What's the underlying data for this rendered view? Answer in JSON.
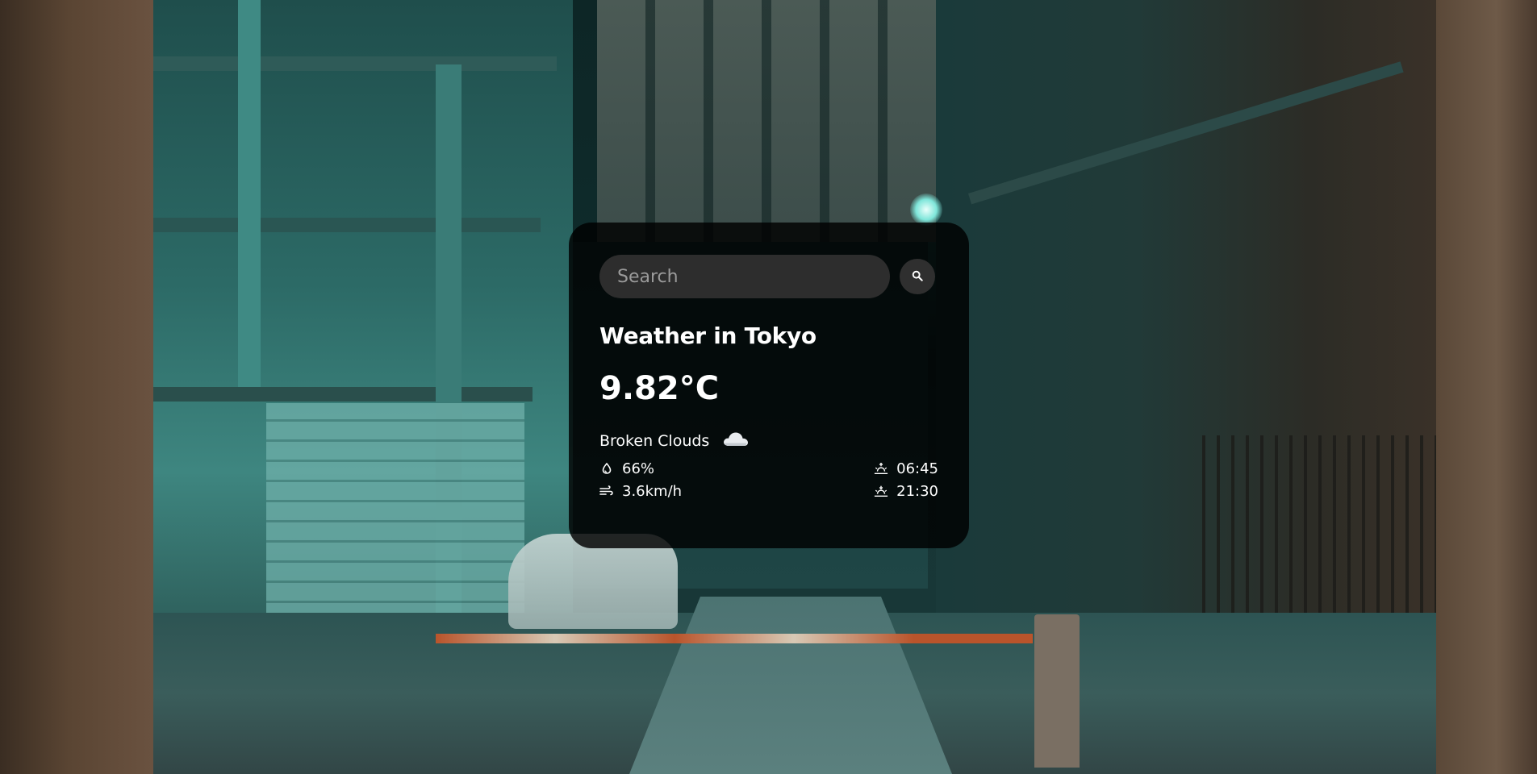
{
  "search": {
    "placeholder": "Search",
    "button_icon": "search-icon"
  },
  "weather": {
    "city_title": "Weather in Tokyo",
    "temperature": "9.82°C",
    "description": "Broken Clouds",
    "description_icon": "cloud-icon",
    "humidity": "66%",
    "humidity_icon": "water-drop-icon",
    "wind_speed": "3.6km/h",
    "wind_icon": "wind-icon",
    "sunrise": "06:45",
    "sunrise_icon": "sunrise-icon",
    "sunset": "21:30",
    "sunset_icon": "sunset-icon"
  },
  "colors": {
    "card_background": "#000000",
    "text": "#ffffff",
    "input_background": "#2d2d2d"
  }
}
